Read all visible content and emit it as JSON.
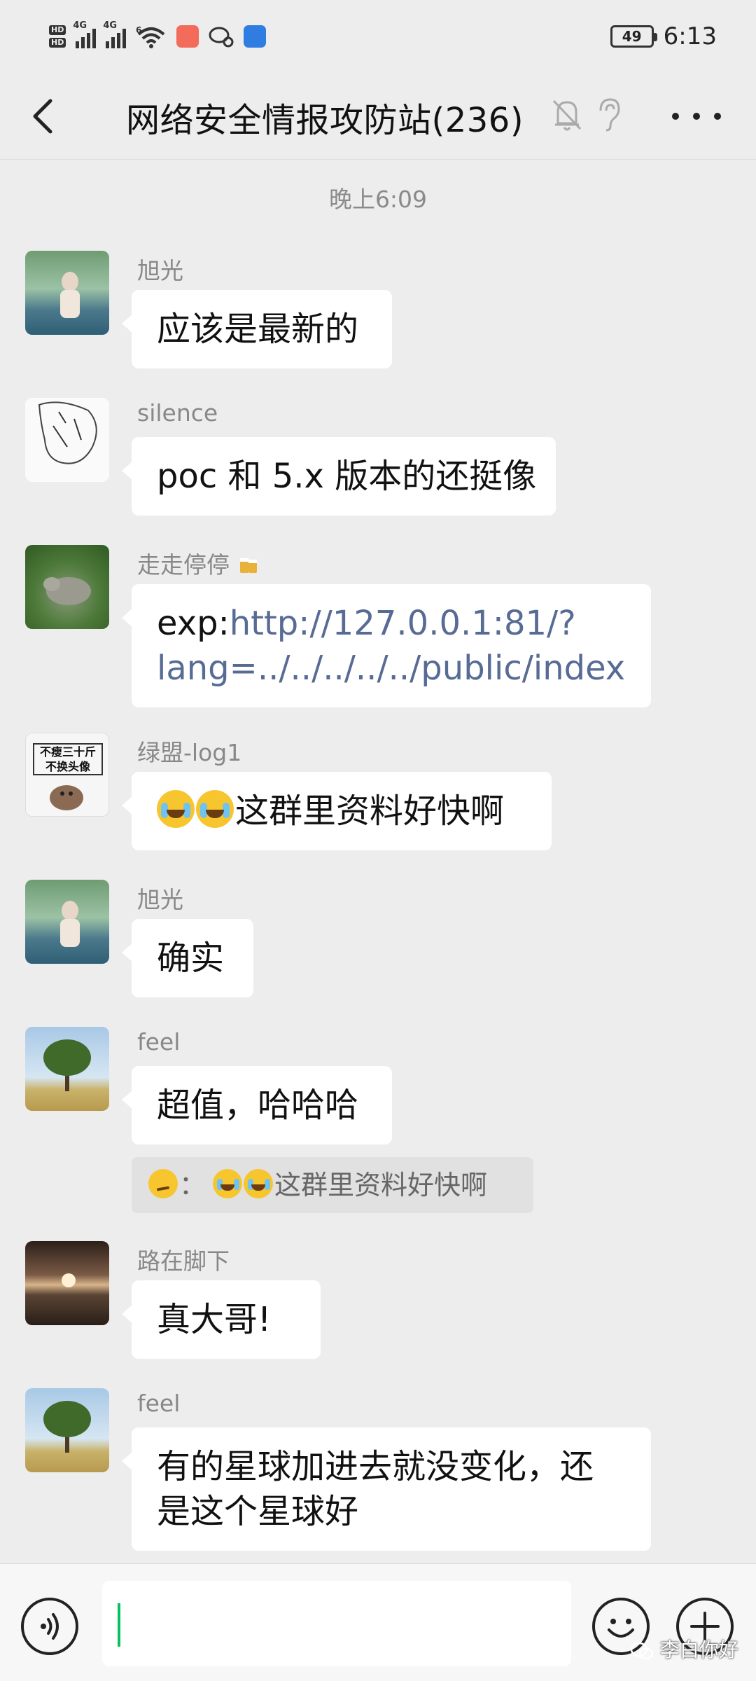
{
  "status_bar": {
    "hd_badges": [
      "HD",
      "HD"
    ],
    "signal_tags": [
      "4G",
      "4G",
      "6"
    ],
    "battery": "49",
    "time": "6:13"
  },
  "header": {
    "title": "网络安全情报攻防站(236)",
    "icons": [
      "back-icon",
      "mute-bell-icon",
      "ear-icon",
      "more-icon"
    ]
  },
  "chat": {
    "timestamp": "晚上6:09",
    "messages": [
      {
        "sender": "旭光",
        "text": "应该是最新的"
      },
      {
        "sender": "silence",
        "text": "poc 和 5.x 版本的还挺像"
      },
      {
        "sender": "走走停停",
        "prefix": "exp:",
        "link_line1": "http://127.0.0.1:81/?",
        "link_line2": "lang=../../../../../public/index"
      },
      {
        "sender": "绿盟-log1",
        "text": "这群里资料好快啊",
        "avatar_text_1": "不瘦三十斤",
        "avatar_text_2": "不换头像"
      },
      {
        "sender": "旭光",
        "text": "确实"
      },
      {
        "sender": "feel",
        "text": "超值，哈哈哈",
        "quote_sep": "：",
        "quote_text": "这群里资料好快啊"
      },
      {
        "sender": "路在脚下",
        "text": "真大哥!"
      },
      {
        "sender": "feel",
        "line1": "有的星球加进去就没变化，还",
        "line2": "是这个星球好"
      }
    ]
  },
  "watermark": "李白你好",
  "colors": {
    "background": "#ededed",
    "bubble": "#ffffff",
    "link": "#576b95",
    "caret": "#07c160"
  }
}
